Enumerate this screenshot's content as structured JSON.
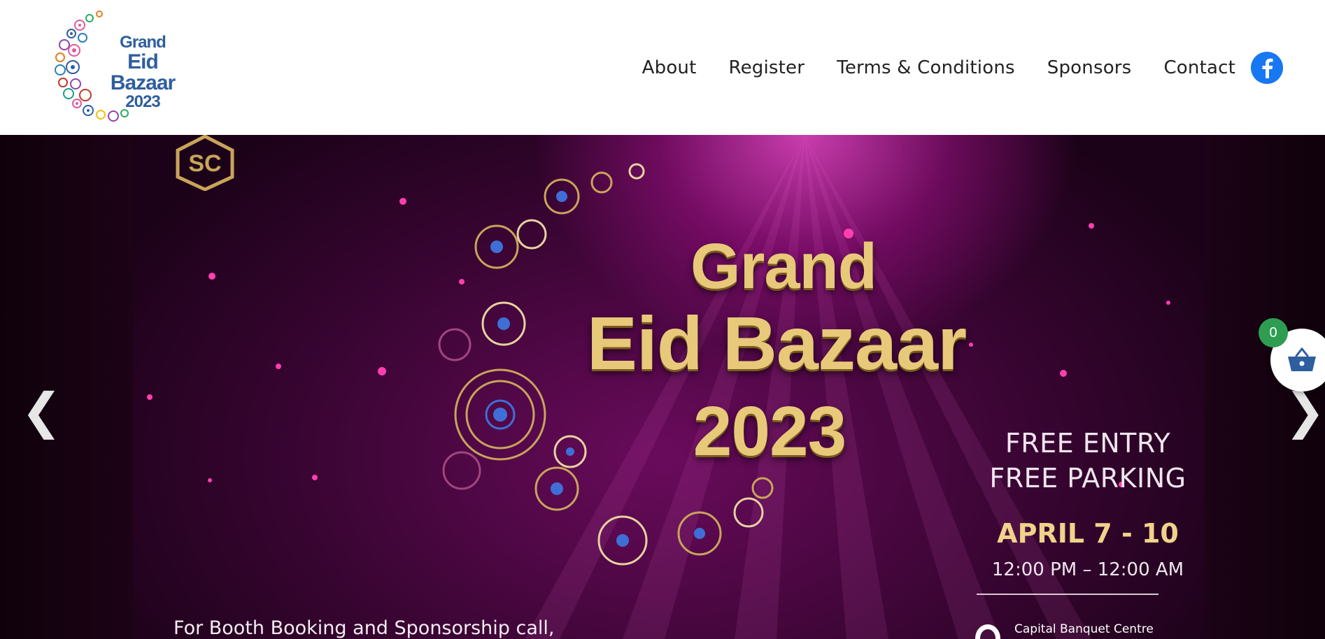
{
  "header": {
    "logo": {
      "line1": "Grand",
      "line2": "Eid Bazaar",
      "line3": "2023"
    },
    "nav": [
      {
        "label": "About"
      },
      {
        "label": "Register"
      },
      {
        "label": "Terms & Conditions"
      },
      {
        "label": "Sponsors"
      },
      {
        "label": "Contact"
      }
    ],
    "social_icon": "facebook-icon",
    "social_color": "#1877f2"
  },
  "hero": {
    "title_line1": "Grand",
    "title_line2": "Eid Bazaar",
    "title_line3": "2023",
    "free_entry": "FREE ENTRY",
    "free_parking": "FREE PARKING",
    "dates": "APRIL 7 - 10",
    "hours": "12:00 PM – 12:00 AM",
    "venue": "Capital Banquet Centre",
    "booking": "For Booth Booking and Sponsorship call,",
    "prev_arrow": "❮",
    "next_arrow": "❯"
  },
  "cart": {
    "count": "0",
    "icon": "basket-icon",
    "badge_color": "#2e9d52"
  },
  "colors": {
    "accent_gold": "#e8c97a",
    "banner_purple": "#6a0b5c",
    "logo_blue": "#2f5e9e"
  }
}
